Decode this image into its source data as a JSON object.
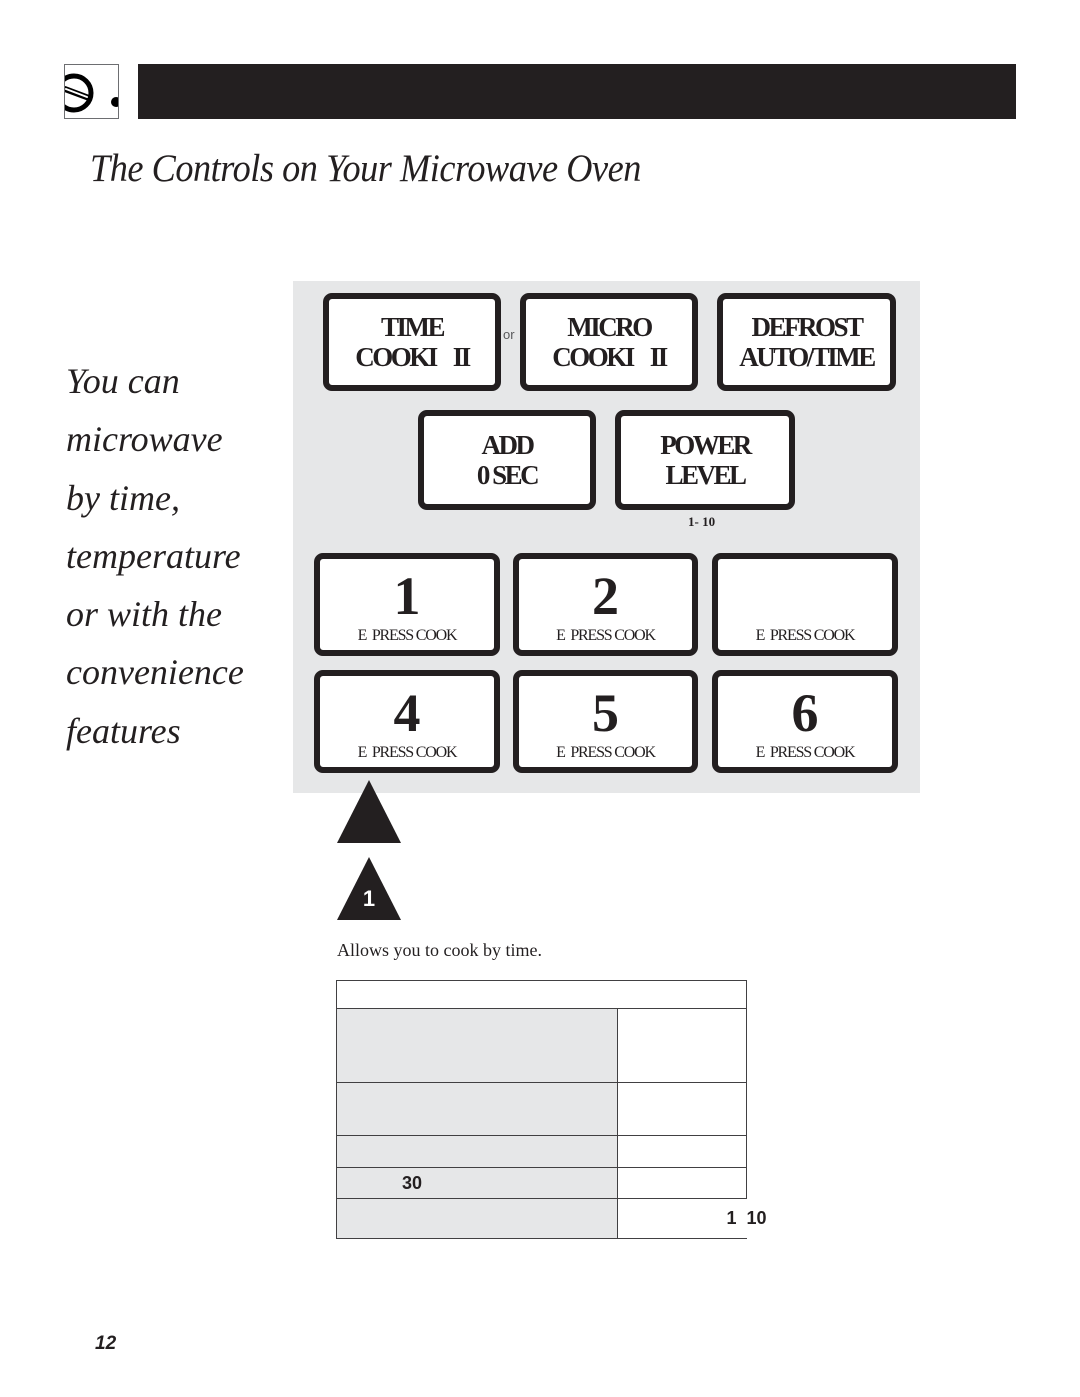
{
  "header": {
    "logo_icon": "timer-dial-icon",
    "bar_color": "#231f20"
  },
  "page_title": "The Controls on Your Microwave Oven",
  "side_text": [
    "You can",
    "microwave",
    "by time,",
    "temperature",
    "or with the",
    "convenience",
    "features"
  ],
  "panel": {
    "background": "#e6e7e8",
    "top_row": [
      {
        "line1": "TIME",
        "line2": "COOKI    II"
      },
      {
        "line1": "MICRO",
        "line2": "COOKI    II"
      },
      {
        "line1": "DEFROST",
        "line2": "AUTO/TIME"
      }
    ],
    "or_label": "or",
    "middle_row": [
      {
        "line1": "ADD",
        "line2": "0 SEC"
      },
      {
        "line1": "POWER",
        "line2": "LEVEL"
      }
    ],
    "power_range": "1- 10",
    "number_keys": [
      {
        "number": "1",
        "label": "E  PRESS COOK"
      },
      {
        "number": "2",
        "label": "E  PRESS COOK"
      },
      {
        "number": "",
        "label": "E  PRESS COOK"
      },
      {
        "number": "4",
        "label": "E  PRESS COOK"
      },
      {
        "number": "5",
        "label": "E  PRESS COOK"
      },
      {
        "number": "6",
        "label": "E  PRESS COOK"
      }
    ]
  },
  "callouts": {
    "first_number": "",
    "second_number": "1"
  },
  "description": "Allows you to cook by time.",
  "table": {
    "header": "",
    "rows": [
      {
        "left": "",
        "right": ""
      },
      {
        "left": "",
        "right": ""
      },
      {
        "left": "",
        "right": ""
      },
      {
        "left": "30",
        "right": ""
      },
      {
        "left": "",
        "right": "1  10"
      }
    ]
  },
  "page_number": "12"
}
